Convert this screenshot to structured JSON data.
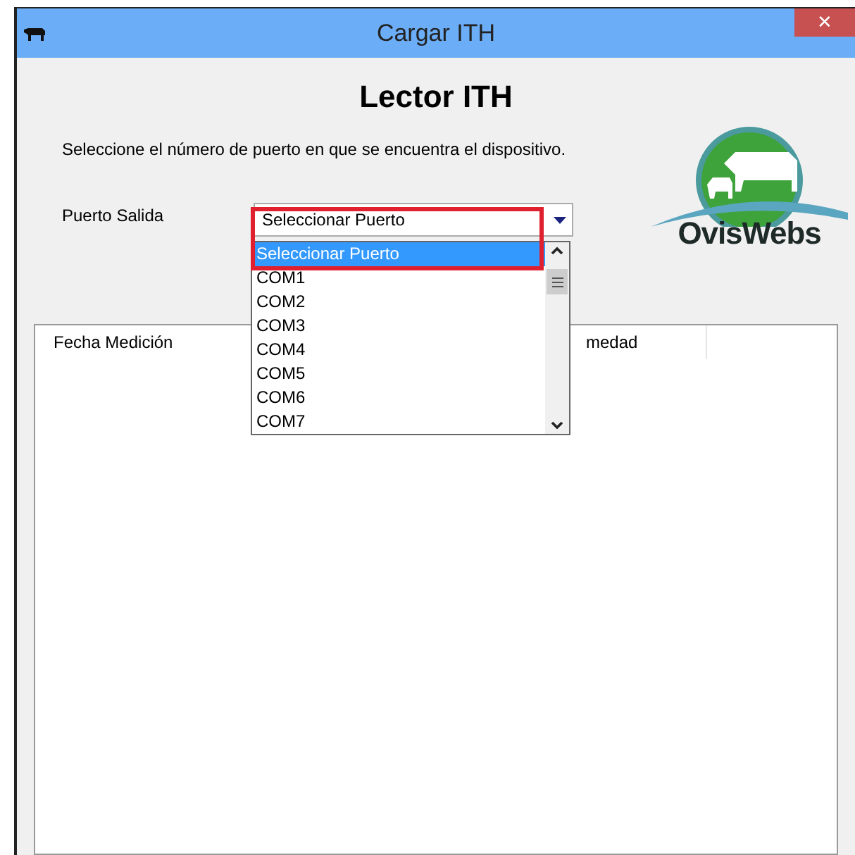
{
  "window": {
    "title": "Cargar ITH",
    "close": "✕"
  },
  "heading": "Lector ITH",
  "instruction": "Seleccione el número de puerto en que se encuentra el dispositivo.",
  "logo": {
    "text": "OvisWebs"
  },
  "port": {
    "label": "Puerto Salida",
    "value": "Seleccionar Puerto",
    "expanded": true,
    "options": [
      {
        "label": "Seleccionar Puerto",
        "selected": true
      },
      {
        "label": "COM1",
        "selected": false
      },
      {
        "label": "COM2",
        "selected": false
      },
      {
        "label": "COM3",
        "selected": false
      },
      {
        "label": "COM4",
        "selected": false
      },
      {
        "label": "COM5",
        "selected": false
      },
      {
        "label": "COM6",
        "selected": false
      },
      {
        "label": "COM7",
        "selected": false
      }
    ]
  },
  "table": {
    "columns": [
      "Fecha Medición",
      "medad"
    ]
  }
}
